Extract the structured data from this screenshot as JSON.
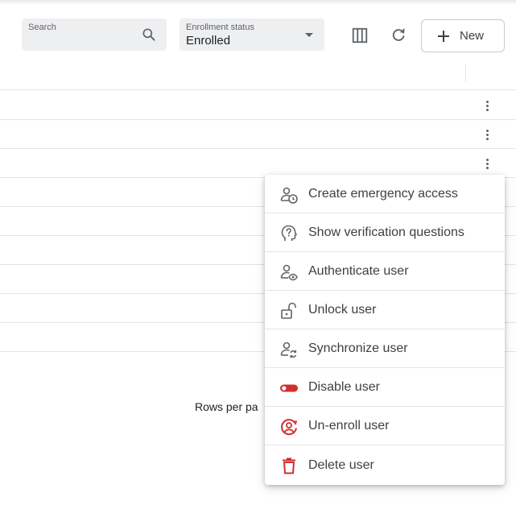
{
  "toolbar": {
    "search_label": "Search",
    "search_value": "",
    "enrollment_label": "Enrollment status",
    "enrollment_value": "Enrolled",
    "new_label": "New"
  },
  "table": {
    "rows_per_page_label": "Rows per pa"
  },
  "menu": {
    "items": [
      {
        "label": "Create emergency access",
        "icon": "user-clock-icon",
        "color": "#5f6368"
      },
      {
        "label": "Show verification questions",
        "icon": "head-question-icon",
        "color": "#5f6368"
      },
      {
        "label": "Authenticate user",
        "icon": "user-eye-icon",
        "color": "#5f6368"
      },
      {
        "label": "Unlock user",
        "icon": "unlock-icon",
        "color": "#5f6368"
      },
      {
        "label": "Synchronize user",
        "icon": "user-sync-icon",
        "color": "#5f6368"
      },
      {
        "label": "Disable user",
        "icon": "toggle-off-icon",
        "color": "#d32f2f"
      },
      {
        "label": "Un-enroll user",
        "icon": "user-remove-circle-icon",
        "color": "#d32f2f"
      },
      {
        "label": "Delete user",
        "icon": "trash-icon",
        "color": "#d32f2f"
      }
    ]
  }
}
